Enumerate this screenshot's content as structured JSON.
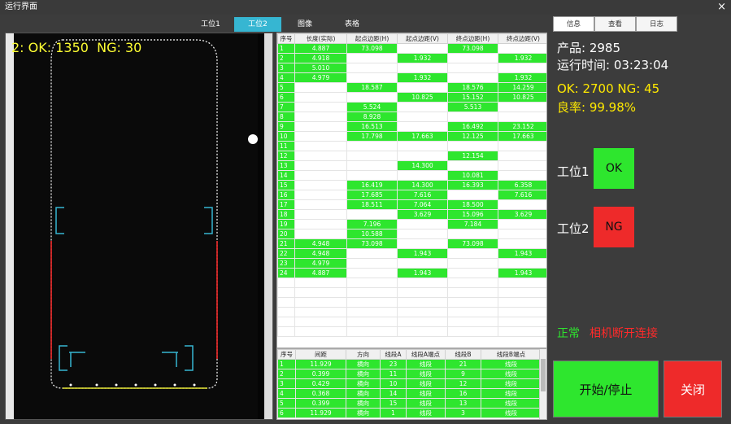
{
  "window": {
    "title": "运行界面",
    "close_label": "×"
  },
  "top_tabs": [
    {
      "label": "工位1",
      "active": false
    },
    {
      "label": "工位2",
      "active": true
    },
    {
      "label": "图像",
      "active": false
    },
    {
      "label": "表格",
      "active": false
    }
  ],
  "image_panel": {
    "overlay_text": "2: OK: 1350  NG: 30"
  },
  "measure_table": {
    "headers": [
      "序号",
      "长度(实际)",
      "起点边距(H)",
      "起点边距(V)",
      "终点边距(H)",
      "终点边距(V)"
    ],
    "rows": [
      [
        "1",
        "4.887",
        "73.098",
        "",
        "73.098",
        ""
      ],
      [
        "2",
        "4.918",
        "",
        "1.932",
        "",
        "1.932"
      ],
      [
        "3",
        "5.010",
        "",
        "",
        "",
        ""
      ],
      [
        "4",
        "4.979",
        "",
        "1.932",
        "",
        "1.932"
      ],
      [
        "5",
        "",
        "18.587",
        "",
        "18.576",
        "14.259"
      ],
      [
        "6",
        "",
        "",
        "10.825",
        "15.152",
        "10.825"
      ],
      [
        "7",
        "",
        "5.524",
        "",
        "5.513",
        ""
      ],
      [
        "8",
        "",
        "8.928",
        "",
        "",
        ""
      ],
      [
        "9",
        "",
        "16.513",
        "",
        "16.492",
        "23.152"
      ],
      [
        "10",
        "",
        "17.798",
        "17.663",
        "12.125",
        "17.663"
      ],
      [
        "11",
        "",
        "",
        "",
        "",
        ""
      ],
      [
        "12",
        "",
        "",
        "",
        "12.154",
        ""
      ],
      [
        "13",
        "",
        "",
        "14.300",
        "",
        ""
      ],
      [
        "14",
        "",
        "",
        "",
        "10.081",
        ""
      ],
      [
        "15",
        "",
        "16.419",
        "14.300",
        "16.393",
        "6.358"
      ],
      [
        "16",
        "",
        "17.685",
        "7.616",
        "",
        "7.616"
      ],
      [
        "17",
        "",
        "18.511",
        "7.064",
        "18.500",
        ""
      ],
      [
        "18",
        "",
        "",
        "3.629",
        "15.096",
        "3.629"
      ],
      [
        "19",
        "",
        "7.196",
        "",
        "7.184",
        ""
      ],
      [
        "20",
        "",
        "10.588",
        "",
        "",
        ""
      ],
      [
        "21",
        "4.948",
        "73.098",
        "",
        "73.098",
        ""
      ],
      [
        "22",
        "4.948",
        "",
        "1.943",
        "",
        "1.943"
      ],
      [
        "23",
        "4.979",
        "",
        "",
        "",
        ""
      ],
      [
        "24",
        "4.887",
        "",
        "1.943",
        "",
        "1.943"
      ]
    ]
  },
  "gap_table": {
    "headers": [
      "序号",
      "间距",
      "方向",
      "线段A",
      "线段A端点",
      "线段B",
      "线段B端点"
    ],
    "rows": [
      [
        "1",
        "11.929",
        "横向",
        "23",
        "线段",
        "21",
        "线段"
      ],
      [
        "2",
        "0.399",
        "横向",
        "11",
        "线段",
        "9",
        "线段"
      ],
      [
        "3",
        "0.429",
        "横向",
        "10",
        "线段",
        "12",
        "线段"
      ],
      [
        "4",
        "0.368",
        "横向",
        "14",
        "线段",
        "16",
        "线段"
      ],
      [
        "5",
        "0.399",
        "横向",
        "15",
        "线段",
        "13",
        "线段"
      ],
      [
        "6",
        "11.929",
        "横向",
        "1",
        "线段",
        "3",
        "线段"
      ]
    ]
  },
  "right_tabs": [
    {
      "label": "信息",
      "active": true
    },
    {
      "label": "查看",
      "active": false
    },
    {
      "label": "日志",
      "active": false
    }
  ],
  "info": {
    "product": "产品:  2985",
    "runtime": "运行时间:  03:23:04",
    "okng": "OK:  2700     NG:  45",
    "yield": "良率:  99.98%"
  },
  "stations": [
    {
      "label": "工位1",
      "status": "OK",
      "color": "#2ee62e"
    },
    {
      "label": "工位2",
      "status": "NG",
      "color": "#ee2a2a"
    }
  ],
  "status": {
    "normal": "正常",
    "camera": "相机断开连接"
  },
  "buttons": {
    "start_stop": "开始/停止",
    "close": "关闭"
  }
}
